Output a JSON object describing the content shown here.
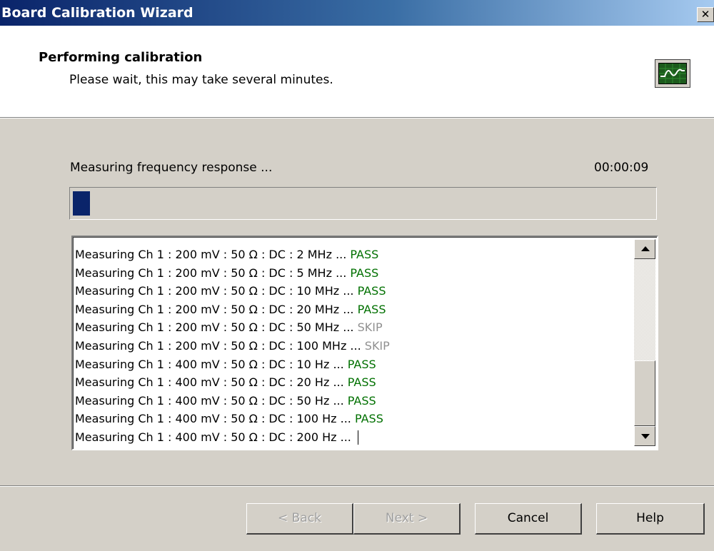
{
  "window": {
    "title": "Board Calibration Wizard",
    "close_label": "✕"
  },
  "header": {
    "title": "Performing calibration",
    "subtitle": "Please wait, this may take several minutes.",
    "icon": "oscilloscope-icon"
  },
  "status": {
    "message": "Measuring frequency response ...",
    "elapsed": "00:00:09",
    "progress_fraction": 0.03
  },
  "log": {
    "lines": [
      {
        "text": "Measuring Ch 1 : 200 mV : 50 Ω : DC : 2 MHz ... ",
        "result": "PASS"
      },
      {
        "text": "Measuring Ch 1 : 200 mV : 50 Ω : DC : 5 MHz ... ",
        "result": "PASS"
      },
      {
        "text": "Measuring Ch 1 : 200 mV : 50 Ω : DC : 10 MHz ... ",
        "result": "PASS"
      },
      {
        "text": "Measuring Ch 1 : 200 mV : 50 Ω : DC : 20 MHz ... ",
        "result": "PASS"
      },
      {
        "text": "Measuring Ch 1 : 200 mV : 50 Ω : DC : 50 MHz ... ",
        "result": "SKIP"
      },
      {
        "text": "Measuring Ch 1 : 200 mV : 50 Ω : DC : 100 MHz ... ",
        "result": "SKIP"
      },
      {
        "text": "Measuring Ch 1 : 400 mV : 50 Ω : DC : 10 Hz ... ",
        "result": "PASS"
      },
      {
        "text": "Measuring Ch 1 : 400 mV : 50 Ω : DC : 20 Hz ... ",
        "result": "PASS"
      },
      {
        "text": "Measuring Ch 1 : 400 mV : 50 Ω : DC : 50 Hz ... ",
        "result": "PASS"
      },
      {
        "text": "Measuring Ch 1 : 400 mV : 50 Ω : DC : 100 Hz ... ",
        "result": "PASS"
      },
      {
        "text": "Measuring Ch 1 : 400 mV : 50 Ω : DC : 200 Hz ... ",
        "result": ""
      }
    ]
  },
  "buttons": {
    "back": "< Back",
    "next": "Next >",
    "cancel": "Cancel",
    "help": "Help"
  },
  "colors": {
    "pass": "#007000",
    "skip": "#909090",
    "progress": "#0a246a"
  }
}
